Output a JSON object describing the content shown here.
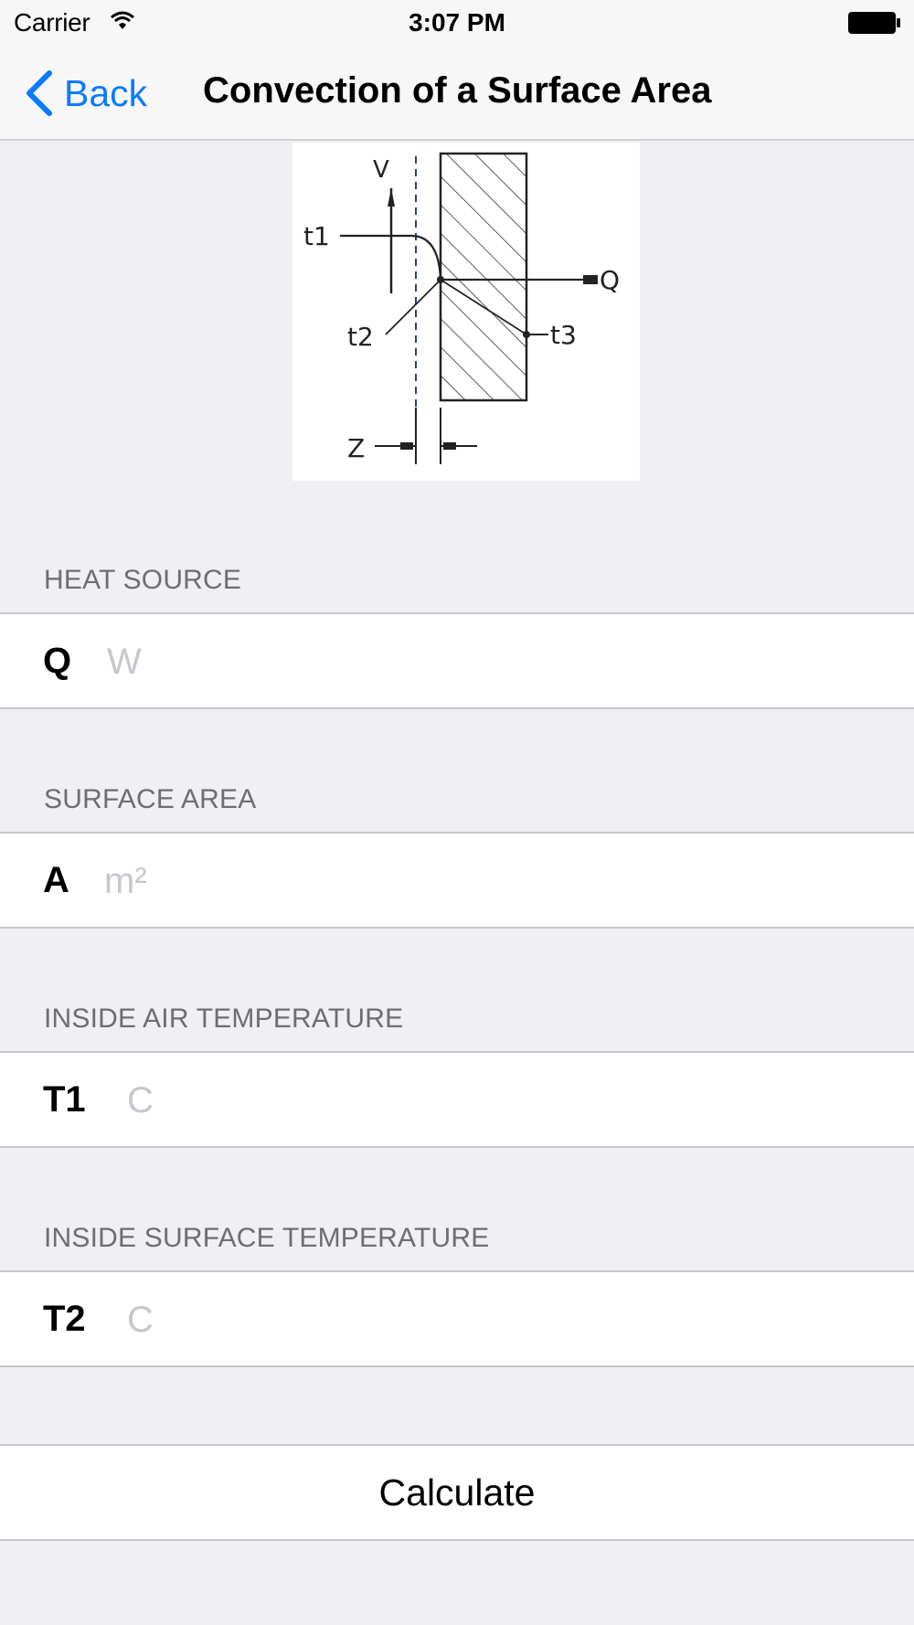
{
  "status_bar": {
    "carrier": "Carrier",
    "time": "3:07 PM"
  },
  "nav": {
    "back_label": "Back",
    "title": "Convection of a Surface Area",
    "accent_color": "#0a7aff"
  },
  "diagram": {
    "labels": {
      "v": "V",
      "t1": "t1",
      "t2": "t2",
      "t3": "t3",
      "q": "Q",
      "z": "Z"
    }
  },
  "form": {
    "sections": [
      {
        "header": "HEAT SOURCE",
        "label": "Q",
        "placeholder": "W",
        "value": ""
      },
      {
        "header": "SURFACE AREA",
        "label": "A",
        "placeholder": "m²",
        "value": ""
      },
      {
        "header": "INSIDE AIR TEMPERATURE",
        "label": "T1",
        "placeholder": "C",
        "value": ""
      },
      {
        "header": "INSIDE SURFACE TEMPERATURE",
        "label": "T2",
        "placeholder": "C",
        "value": ""
      }
    ],
    "calculate_label": "Calculate"
  }
}
